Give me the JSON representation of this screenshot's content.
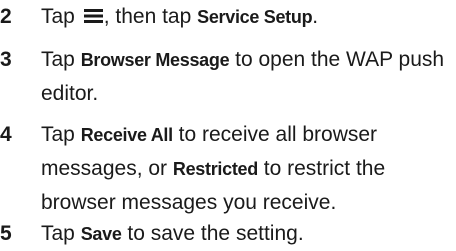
{
  "steps": [
    {
      "number": "2",
      "parts": {
        "t1": "Tap ",
        "t2": ", then tap ",
        "k1": "Service Setup",
        "t3": "."
      },
      "icon": "menu-icon"
    },
    {
      "number": "3",
      "parts": {
        "t1": "Tap ",
        "k1": "Browser Message",
        "t2": " to open the WAP push",
        "t3": "editor."
      }
    },
    {
      "number": "4",
      "parts": {
        "t1": "Tap ",
        "k1": "Receive All",
        "t2": " to receive all browser",
        "t3": "messages, or ",
        "k2": "Restricted",
        "t4": " to restrict the",
        "t5": "browser messages you receive."
      }
    },
    {
      "number": "5",
      "parts": {
        "t1": "Tap ",
        "k1": "Save",
        "t2": " to save the setting."
      }
    }
  ]
}
